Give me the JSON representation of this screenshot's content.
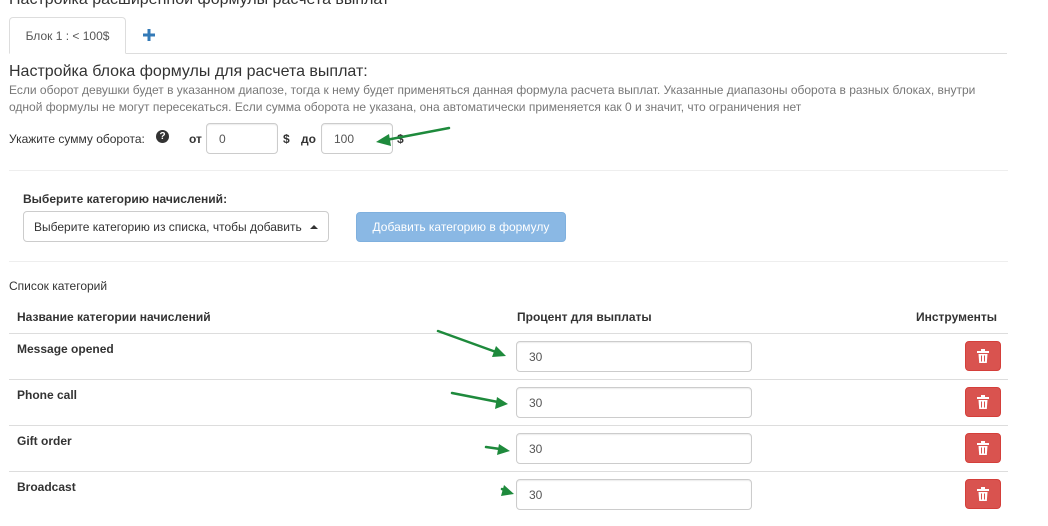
{
  "page": {
    "title": "Настройка расширенной формулы расчета выплат"
  },
  "tabs": {
    "items": [
      {
        "label": "Блок 1 : < 100$"
      }
    ],
    "add_label": "+"
  },
  "formula_block": {
    "title": "Настройка блока формулы для расчета выплат:",
    "help": "Если оборот девушки будет в указанном диапозе, тогда к нему будет применяться данная формула расчета выплат. Указанные диапазоны оборота в разных блоках, внутри одной формулы не могут пересекаться. Если сумма оборота не указана, она автоматически применяется как 0 и значит, что ограничения нет",
    "range_label": "Укажите сумму оборота:",
    "help_icon": "question-circle-icon",
    "from_label": "от",
    "from_value": "0",
    "currency_1": "$",
    "to_label": "до",
    "to_value": "100",
    "currency_2": "$"
  },
  "category_select": {
    "label": "Выберите категорию начислений:",
    "selected": "Выберите категорию из списка, чтобы добавить",
    "add_button": "Добавить категорию в формулу"
  },
  "categories": {
    "title": "Список категорий",
    "columns": {
      "name": "Название категории начислений",
      "percent": "Процент для выплаты",
      "tools": "Инструменты"
    },
    "rows": [
      {
        "name": "Message opened",
        "percent": "30"
      },
      {
        "name": "Phone call",
        "percent": "30"
      },
      {
        "name": "Gift order",
        "percent": "30"
      },
      {
        "name": "Broadcast",
        "percent": "30"
      }
    ],
    "delete_icon": "trash-icon"
  },
  "colors": {
    "accent_blue": "#337ab7",
    "button_light_blue": "#8ab8e4",
    "danger_red": "#d9534f",
    "arrow_green": "#1e8a3c",
    "muted_text": "#777777"
  }
}
